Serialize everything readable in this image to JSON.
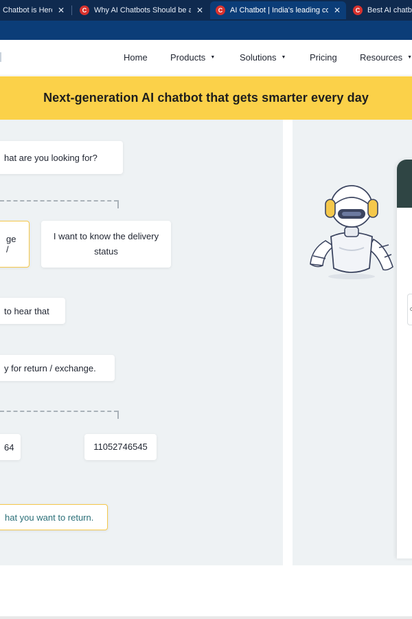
{
  "browser": {
    "tabs": [
      {
        "title": "Chatbot is Here t",
        "active": false,
        "has_favicon": false
      },
      {
        "title": "Why AI Chatbots Should be a Pa",
        "active": false,
        "has_favicon": true
      },
      {
        "title": "AI Chatbot | India's leading conv",
        "active": true,
        "has_favicon": true
      },
      {
        "title": "Best AI chatbot",
        "active": false,
        "has_favicon": true
      }
    ],
    "favicon_glyph": "C",
    "close_glyph": "✕"
  },
  "nav": {
    "items": [
      {
        "label": "Home",
        "has_caret": false
      },
      {
        "label": "Products",
        "has_caret": true
      },
      {
        "label": "Solutions",
        "has_caret": true
      },
      {
        "label": "Pricing",
        "has_caret": false
      },
      {
        "label": "Resources",
        "has_caret": true
      }
    ],
    "caret_glyph": "▼"
  },
  "banner": {
    "text": "Next-generation AI chatbot that gets smarter every day",
    "color": "#fbd149"
  },
  "chat": {
    "question": "hat are you looking for?",
    "option_left": "ge /",
    "option_right": "I want to know the delivery status",
    "sorry": "to hear that",
    "return_prompt": "y for return / exchange.",
    "order_left": "64",
    "order_right": "11052746545",
    "final": "hat you want to return."
  },
  "colors": {
    "accent_yellow": "#f5c84b",
    "navy": "#0b3d78",
    "teal_text": "#2b6f78",
    "phone_header": "#2f4544"
  }
}
